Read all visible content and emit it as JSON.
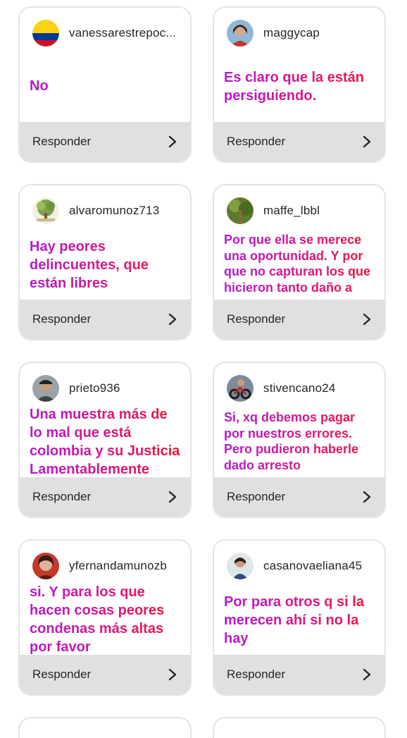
{
  "cards": [
    {
      "username": "vanessarestrepoc...",
      "avatar": "colombia-flag-avatar",
      "message": "No",
      "reply_label": "Responder"
    },
    {
      "username": "maggycap",
      "avatar": "woman-portrait-avatar",
      "message": "Es claro que la están persiguiendo.",
      "reply_label": "Responder"
    },
    {
      "username": "alvaromunoz713",
      "avatar": "tree-logo-avatar",
      "message": "Hay peores delincuentes, que están libres",
      "reply_label": "Responder"
    },
    {
      "username": "maffe_lbbl",
      "avatar": "plant-avatar",
      "message": "Por que ella se merece una oportunidad. Y por que no capturan los que hicieron tanto daño a cali",
      "reply_label": "Responder"
    },
    {
      "username": "prieto936",
      "avatar": "man-portrait-avatar",
      "message": "Una muestra más de lo mal que está colombia y su Justicia Lamentablemente",
      "reply_label": "Responder"
    },
    {
      "username": "stivencano24",
      "avatar": "motorcycle-avatar",
      "message": "Si, xq debemos pagar por nuestros errores. Pero pudieron haberle dado arresto domiciliario",
      "reply_label": "Responder"
    },
    {
      "username": "yfernandamunozb",
      "avatar": "woman-red-avatar",
      "message": "si. Y para los que hacen cosas peores condenas más altas por favor",
      "reply_label": "Responder"
    },
    {
      "username": "casanovaeliana45",
      "avatar": "woman-outdoor-avatar",
      "message": "Por para otros q si la merecen ahí si no la hay",
      "reply_label": "Responder"
    }
  ],
  "colors": {
    "card_border": "#e4e4e4",
    "footer_bg": "#e0e0e0",
    "message_gradient": [
      "#b31ad1",
      "#e0167a",
      "#f0152f"
    ],
    "text": "#262626"
  }
}
